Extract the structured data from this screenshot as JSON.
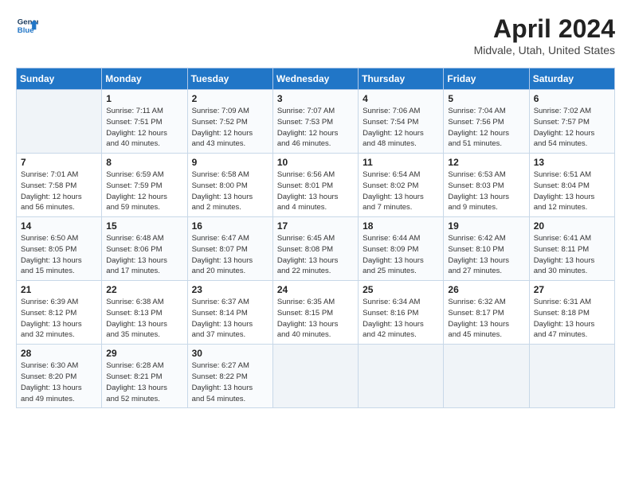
{
  "header": {
    "logo_line1": "General",
    "logo_line2": "Blue",
    "title": "April 2024",
    "subtitle": "Midvale, Utah, United States"
  },
  "columns": [
    "Sunday",
    "Monday",
    "Tuesday",
    "Wednesday",
    "Thursday",
    "Friday",
    "Saturday"
  ],
  "weeks": [
    [
      {
        "day": "",
        "info": ""
      },
      {
        "day": "1",
        "info": "Sunrise: 7:11 AM\nSunset: 7:51 PM\nDaylight: 12 hours\nand 40 minutes."
      },
      {
        "day": "2",
        "info": "Sunrise: 7:09 AM\nSunset: 7:52 PM\nDaylight: 12 hours\nand 43 minutes."
      },
      {
        "day": "3",
        "info": "Sunrise: 7:07 AM\nSunset: 7:53 PM\nDaylight: 12 hours\nand 46 minutes."
      },
      {
        "day": "4",
        "info": "Sunrise: 7:06 AM\nSunset: 7:54 PM\nDaylight: 12 hours\nand 48 minutes."
      },
      {
        "day": "5",
        "info": "Sunrise: 7:04 AM\nSunset: 7:56 PM\nDaylight: 12 hours\nand 51 minutes."
      },
      {
        "day": "6",
        "info": "Sunrise: 7:02 AM\nSunset: 7:57 PM\nDaylight: 12 hours\nand 54 minutes."
      }
    ],
    [
      {
        "day": "7",
        "info": "Sunrise: 7:01 AM\nSunset: 7:58 PM\nDaylight: 12 hours\nand 56 minutes."
      },
      {
        "day": "8",
        "info": "Sunrise: 6:59 AM\nSunset: 7:59 PM\nDaylight: 12 hours\nand 59 minutes."
      },
      {
        "day": "9",
        "info": "Sunrise: 6:58 AM\nSunset: 8:00 PM\nDaylight: 13 hours\nand 2 minutes."
      },
      {
        "day": "10",
        "info": "Sunrise: 6:56 AM\nSunset: 8:01 PM\nDaylight: 13 hours\nand 4 minutes."
      },
      {
        "day": "11",
        "info": "Sunrise: 6:54 AM\nSunset: 8:02 PM\nDaylight: 13 hours\nand 7 minutes."
      },
      {
        "day": "12",
        "info": "Sunrise: 6:53 AM\nSunset: 8:03 PM\nDaylight: 13 hours\nand 9 minutes."
      },
      {
        "day": "13",
        "info": "Sunrise: 6:51 AM\nSunset: 8:04 PM\nDaylight: 13 hours\nand 12 minutes."
      }
    ],
    [
      {
        "day": "14",
        "info": "Sunrise: 6:50 AM\nSunset: 8:05 PM\nDaylight: 13 hours\nand 15 minutes."
      },
      {
        "day": "15",
        "info": "Sunrise: 6:48 AM\nSunset: 8:06 PM\nDaylight: 13 hours\nand 17 minutes."
      },
      {
        "day": "16",
        "info": "Sunrise: 6:47 AM\nSunset: 8:07 PM\nDaylight: 13 hours\nand 20 minutes."
      },
      {
        "day": "17",
        "info": "Sunrise: 6:45 AM\nSunset: 8:08 PM\nDaylight: 13 hours\nand 22 minutes."
      },
      {
        "day": "18",
        "info": "Sunrise: 6:44 AM\nSunset: 8:09 PM\nDaylight: 13 hours\nand 25 minutes."
      },
      {
        "day": "19",
        "info": "Sunrise: 6:42 AM\nSunset: 8:10 PM\nDaylight: 13 hours\nand 27 minutes."
      },
      {
        "day": "20",
        "info": "Sunrise: 6:41 AM\nSunset: 8:11 PM\nDaylight: 13 hours\nand 30 minutes."
      }
    ],
    [
      {
        "day": "21",
        "info": "Sunrise: 6:39 AM\nSunset: 8:12 PM\nDaylight: 13 hours\nand 32 minutes."
      },
      {
        "day": "22",
        "info": "Sunrise: 6:38 AM\nSunset: 8:13 PM\nDaylight: 13 hours\nand 35 minutes."
      },
      {
        "day": "23",
        "info": "Sunrise: 6:37 AM\nSunset: 8:14 PM\nDaylight: 13 hours\nand 37 minutes."
      },
      {
        "day": "24",
        "info": "Sunrise: 6:35 AM\nSunset: 8:15 PM\nDaylight: 13 hours\nand 40 minutes."
      },
      {
        "day": "25",
        "info": "Sunrise: 6:34 AM\nSunset: 8:16 PM\nDaylight: 13 hours\nand 42 minutes."
      },
      {
        "day": "26",
        "info": "Sunrise: 6:32 AM\nSunset: 8:17 PM\nDaylight: 13 hours\nand 45 minutes."
      },
      {
        "day": "27",
        "info": "Sunrise: 6:31 AM\nSunset: 8:18 PM\nDaylight: 13 hours\nand 47 minutes."
      }
    ],
    [
      {
        "day": "28",
        "info": "Sunrise: 6:30 AM\nSunset: 8:20 PM\nDaylight: 13 hours\nand 49 minutes."
      },
      {
        "day": "29",
        "info": "Sunrise: 6:28 AM\nSunset: 8:21 PM\nDaylight: 13 hours\nand 52 minutes."
      },
      {
        "day": "30",
        "info": "Sunrise: 6:27 AM\nSunset: 8:22 PM\nDaylight: 13 hours\nand 54 minutes."
      },
      {
        "day": "",
        "info": ""
      },
      {
        "day": "",
        "info": ""
      },
      {
        "day": "",
        "info": ""
      },
      {
        "day": "",
        "info": ""
      }
    ]
  ]
}
